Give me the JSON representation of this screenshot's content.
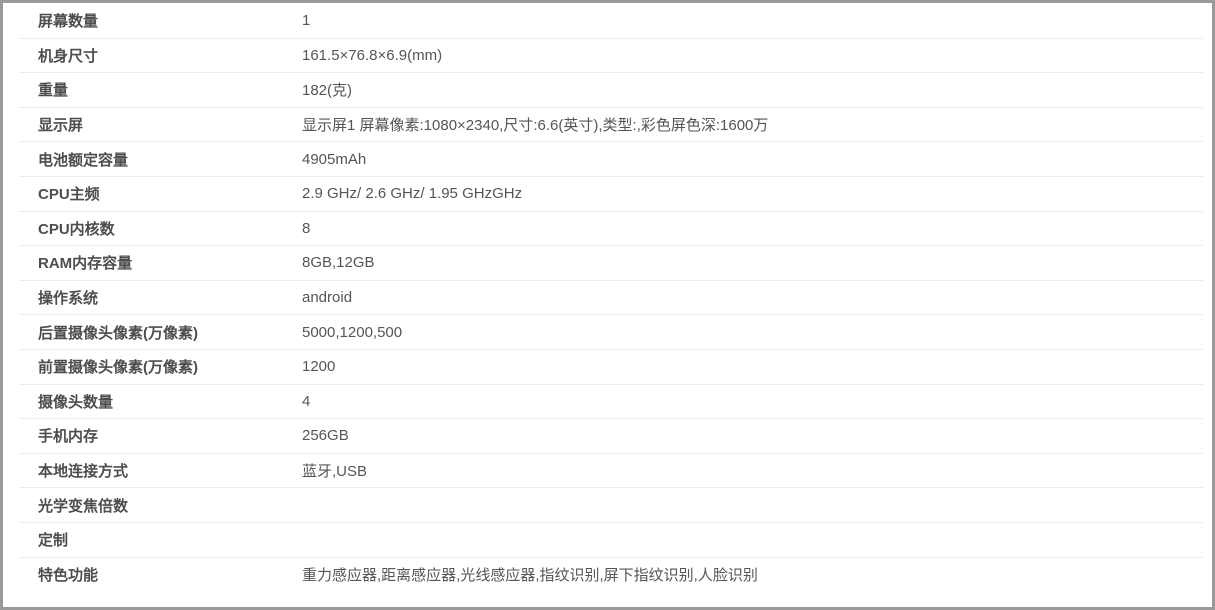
{
  "specs": [
    {
      "label": "屏幕数量",
      "value": "1"
    },
    {
      "label": "机身尺寸",
      "value": "161.5×76.8×6.9(mm)"
    },
    {
      "label": "重量",
      "value": "182(克)"
    },
    {
      "label": "显示屏",
      "value": "显示屏1 屏幕像素:1080×2340,尺寸:6.6(英寸),类型:,彩色屏色深:1600万"
    },
    {
      "label": "电池额定容量",
      "value": "4905mAh"
    },
    {
      "label": "CPU主频",
      "value": "2.9 GHz/ 2.6 GHz/ 1.95 GHzGHz"
    },
    {
      "label": "CPU内核数",
      "value": "8"
    },
    {
      "label": "RAM内存容量",
      "value": "8GB,12GB"
    },
    {
      "label": "操作系统",
      "value": "android"
    },
    {
      "label": "后置摄像头像素(万像素)",
      "value": "5000,1200,500"
    },
    {
      "label": "前置摄像头像素(万像素)",
      "value": "1200"
    },
    {
      "label": "摄像头数量",
      "value": "4"
    },
    {
      "label": "手机内存",
      "value": "256GB"
    },
    {
      "label": "本地连接方式",
      "value": "蓝牙,USB"
    },
    {
      "label": "光学变焦倍数",
      "value": ""
    },
    {
      "label": "定制",
      "value": ""
    },
    {
      "label": "特色功能",
      "value": "重力感应器,距离感应器,光线感应器,指纹识别,屏下指纹识别,人脸识别"
    }
  ]
}
